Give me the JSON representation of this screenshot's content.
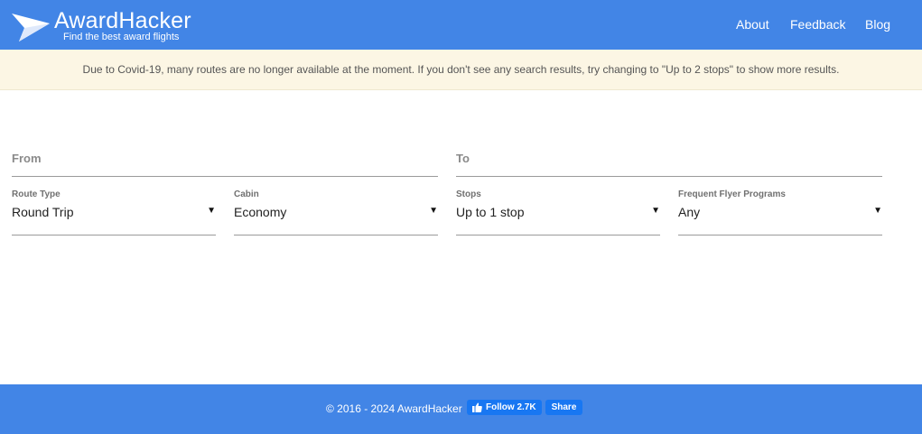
{
  "header": {
    "brand_name": "AwardHacker",
    "tagline": "Find the best award flights",
    "logo_icon": "paper-plane-icon",
    "nav": [
      {
        "label": "About"
      },
      {
        "label": "Feedback"
      },
      {
        "label": "Blog"
      }
    ]
  },
  "banner": {
    "text": "Due to Covid-19, many routes are no longer available at the moment. If you don't see any search results, try changing to \"Up to 2 stops\" to show more results."
  },
  "search": {
    "from_placeholder": "From",
    "to_placeholder": "To",
    "selects": [
      {
        "label": "Route Type",
        "value": "Round Trip"
      },
      {
        "label": "Cabin",
        "value": "Economy"
      },
      {
        "label": "Stops",
        "value": "Up to 1 stop"
      },
      {
        "label": "Frequent Flyer Programs",
        "value": "Any"
      }
    ],
    "arrow": "▼"
  },
  "footer": {
    "copyright": "© 2016 - 2024 AwardHacker",
    "follow_label": "Follow 2.7K",
    "share_label": "Share"
  },
  "colors": {
    "brand_blue": "#4285e6",
    "banner_bg": "#fcf6e4",
    "facebook_blue": "#1877f2"
  }
}
